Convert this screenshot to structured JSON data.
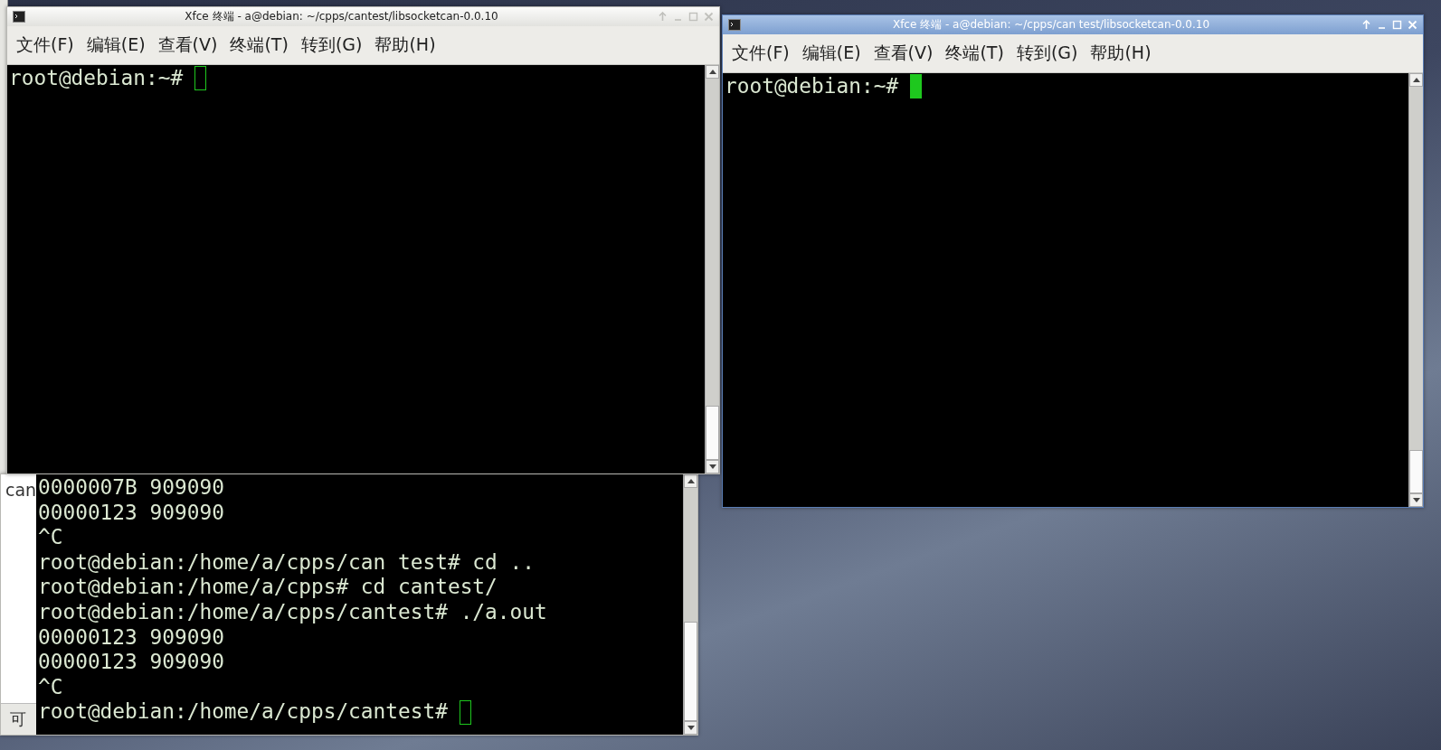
{
  "windows": [
    {
      "title": "Xfce 终端 - a@debian: ~/cpps/cantest/libsocketcan-0.0.10",
      "active": false,
      "cursor_filled": false,
      "menu": [
        "文件(F)",
        "编辑(E)",
        "查看(V)",
        "终端(T)",
        "转到(G)",
        "帮助(H)"
      ],
      "lines": [
        "root@debian:~#"
      ]
    },
    {
      "title": "Xfce 终端 - a@debian: ~/cpps/can test/libsocketcan-0.0.10",
      "active": true,
      "cursor_filled": true,
      "menu": [
        "文件(F)",
        "编辑(E)",
        "查看(V)",
        "终端(T)",
        "转到(G)",
        "帮助(H)"
      ],
      "lines": [
        "root@debian:~#"
      ]
    }
  ],
  "background_window": {
    "side_text": "can",
    "status_text": "可",
    "cursor_filled": false,
    "lines": [
      "0000007B 909090",
      "00000123 909090",
      "^C",
      "root@debian:/home/a/cpps/can test# cd ..",
      "root@debian:/home/a/cpps# cd cantest/",
      "root@debian:/home/a/cpps/cantest# ./a.out",
      "00000123 909090",
      "00000123 909090",
      "^C",
      "root@debian:/home/a/cpps/cantest#"
    ]
  }
}
